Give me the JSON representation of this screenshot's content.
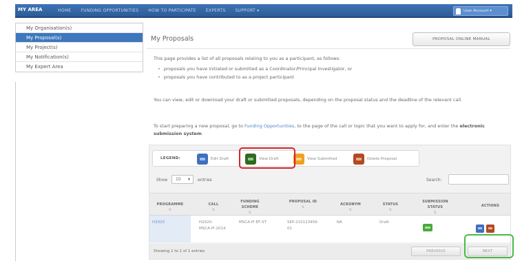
{
  "topbar": {
    "brand": "MY AREA",
    "nav": [
      "HOME",
      "FUNDING OPPORTUNITIES",
      "HOW TO PARTICIPATE",
      "EXPERTS",
      "SUPPORT ▾"
    ],
    "user": "User Account ▾"
  },
  "sidebar": {
    "items": [
      {
        "label": "My Organisation(s)"
      },
      {
        "label": "My Proposal(s)"
      },
      {
        "label": "My Project(s)"
      },
      {
        "label": "My Notification(s)"
      },
      {
        "label": "My Expert Area"
      }
    ]
  },
  "main": {
    "title": "My Proposals",
    "manual_button": "PROPOSAL ONLINE MANUAL",
    "intro": "This page provides a list of all proposals relating to you as a participant, as follows:",
    "bullet1": "proposals you have initiated or submitted as a Coordinator/Principal Investigator, or",
    "bullet2": "proposals you have contributed to as a project participant",
    "para2": "You can view, edit or download your draft or submitted proposals, depending on the proposal status and the deadline of the relevant call.",
    "para3_a": "To start preparing a new proposal, go to ",
    "para3_link": "Funding Opportunities",
    "para3_b": ", to the page of the call or topic that you want to apply for, and enter the ",
    "para3_bold": "electronic submission system",
    "para3_c": "."
  },
  "legend": {
    "title": "LEGEND:",
    "items": [
      {
        "label": "Edit Draft",
        "color": "#3f6fc0"
      },
      {
        "label": "View Draft",
        "color": "#2e6b1f"
      },
      {
        "label": "View Submitted",
        "color": "#f0a01f"
      },
      {
        "label": "Delete Proposal",
        "color": "#b24a23"
      }
    ]
  },
  "table_controls": {
    "show": "Show",
    "show_value": "10",
    "entries": "entries",
    "search": "Search:"
  },
  "table": {
    "headers": [
      "PROGRAMME",
      "CALL",
      "FUNDING SCHEME",
      "PROPOSAL ID",
      "ACRONYM",
      "STATUS",
      "SUBMISSION STATUS",
      "ACTIONS"
    ],
    "rows": [
      {
        "programme": "H2020",
        "call_1": "H2020-",
        "call_2": "MSCA-IF-2014",
        "funding_scheme": "MSCA-IF-EF-ST",
        "proposal_id_1": "SEP-210123456-",
        "proposal_id_2": "01",
        "acronym": "NA",
        "status": "Draft"
      }
    ],
    "showing": "Showing 1 to 1 of 1 entries",
    "previous": "PREVIOUS",
    "next": "NEXT"
  },
  "colors": {
    "accent": "#3d77bd",
    "status_badge": "#49a93b",
    "highlight_red": "#d6232a",
    "highlight_green": "#4cb849"
  }
}
